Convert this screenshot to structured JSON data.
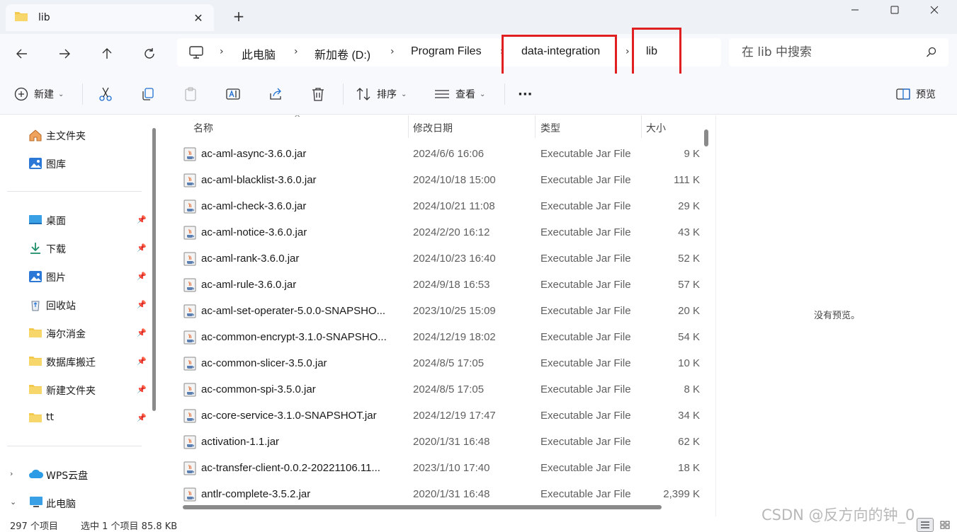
{
  "tab": {
    "title": "lib"
  },
  "window_controls": {
    "minimize": "—",
    "maximize": "□",
    "close": "✕"
  },
  "nav": {
    "back": "←",
    "forward": "→",
    "up": "↑",
    "refresh": "↻"
  },
  "breadcrumb": {
    "items": [
      "此电脑",
      "新加卷 (D:)",
      "Program Files",
      "data-integration",
      "lib"
    ],
    "separator": "›"
  },
  "search": {
    "placeholder": "在 lib 中搜索"
  },
  "toolbar": {
    "new_label": "新建",
    "sort_label": "排序",
    "view_label": "查看",
    "more_label": "···",
    "preview_label": "预览"
  },
  "sidebar": {
    "pinned_top": [
      {
        "label": "主文件夹",
        "icon": "home-icon"
      },
      {
        "label": "图库",
        "icon": "gallery-icon"
      }
    ],
    "quick_access": [
      {
        "label": "桌面",
        "icon": "desktop-icon"
      },
      {
        "label": "下载",
        "icon": "download-icon"
      },
      {
        "label": "图片",
        "icon": "pictures-icon"
      },
      {
        "label": "回收站",
        "icon": "recycle-bin-icon"
      },
      {
        "label": "海尔消金",
        "icon": "folder-icon"
      },
      {
        "label": "数据库搬迁",
        "icon": "folder-icon"
      },
      {
        "label": "新建文件夹",
        "icon": "folder-icon"
      },
      {
        "label": "tt",
        "icon": "folder-icon"
      }
    ],
    "drives": [
      {
        "label": "WPS云盘",
        "icon": "cloud-icon",
        "expander": "›"
      },
      {
        "label": "此电脑",
        "icon": "pc-icon",
        "expander": "⌄"
      }
    ]
  },
  "filelist": {
    "columns": {
      "name": "名称",
      "date": "修改日期",
      "type": "类型",
      "size": "大小"
    },
    "rows": [
      {
        "name": "ac-aml-async-3.6.0.jar",
        "date": "2024/6/6 16:06",
        "type": "Executable Jar File",
        "size": "9 K"
      },
      {
        "name": "ac-aml-blacklist-3.6.0.jar",
        "date": "2024/10/18 15:00",
        "type": "Executable Jar File",
        "size": "111 K"
      },
      {
        "name": "ac-aml-check-3.6.0.jar",
        "date": "2024/10/21 11:08",
        "type": "Executable Jar File",
        "size": "29 K"
      },
      {
        "name": "ac-aml-notice-3.6.0.jar",
        "date": "2024/2/20 16:12",
        "type": "Executable Jar File",
        "size": "43 K"
      },
      {
        "name": "ac-aml-rank-3.6.0.jar",
        "date": "2024/10/23 16:40",
        "type": "Executable Jar File",
        "size": "52 K"
      },
      {
        "name": "ac-aml-rule-3.6.0.jar",
        "date": "2024/9/18 16:53",
        "type": "Executable Jar File",
        "size": "57 K"
      },
      {
        "name": "ac-aml-set-operater-5.0.0-SNAPSHO...",
        "date": "2023/10/25 15:09",
        "type": "Executable Jar File",
        "size": "20 K"
      },
      {
        "name": "ac-common-encrypt-3.1.0-SNAPSHO...",
        "date": "2024/12/19 18:02",
        "type": "Executable Jar File",
        "size": "54 K"
      },
      {
        "name": "ac-common-slicer-3.5.0.jar",
        "date": "2024/8/5 17:05",
        "type": "Executable Jar File",
        "size": "10 K"
      },
      {
        "name": "ac-common-spi-3.5.0.jar",
        "date": "2024/8/5 17:05",
        "type": "Executable Jar File",
        "size": "8 K"
      },
      {
        "name": "ac-core-service-3.1.0-SNAPSHOT.jar",
        "date": "2024/12/19 17:47",
        "type": "Executable Jar File",
        "size": "34 K"
      },
      {
        "name": "activation-1.1.jar",
        "date": "2020/1/31 16:48",
        "type": "Executable Jar File",
        "size": "62 K"
      },
      {
        "name": "ac-transfer-client-0.0.2-20221106.11...",
        "date": "2023/1/10 17:40",
        "type": "Executable Jar File",
        "size": "18 K"
      },
      {
        "name": "antlr-complete-3.5.2.jar",
        "date": "2020/1/31 16:48",
        "type": "Executable Jar File",
        "size": "2,399 K"
      }
    ]
  },
  "preview": {
    "message": "没有预览。"
  },
  "status": {
    "item_count": "297 个项目",
    "selected": "选中 1 个项目  85.8 KB"
  },
  "watermark": "CSDN @反方向的钟_0",
  "colors": {
    "highlight": "#e02020",
    "folder": "#f2c94c",
    "accent": "#1f6fd1"
  }
}
